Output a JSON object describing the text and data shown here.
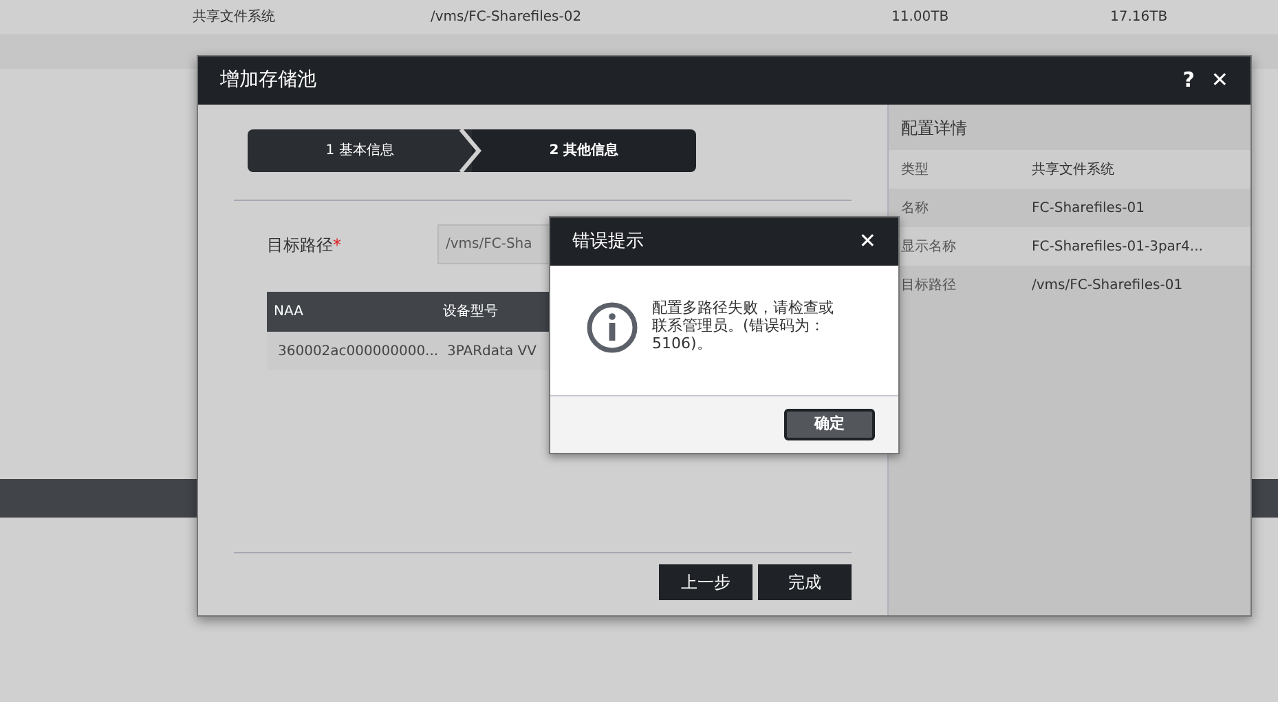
{
  "background_table": {
    "rows": [
      {
        "cells": [
          "共享文件系统",
          "/vms/FC-Sharefiles-02",
          "11.00TB",
          "17.16TB"
        ],
        "selected": false
      }
    ]
  },
  "dialog": {
    "title": "增加存储池",
    "help": "?",
    "close": "✕",
    "steps": [
      {
        "label": "1 基本信息",
        "selected": false
      },
      {
        "label": "2 其他信息",
        "selected": true
      }
    ],
    "target_path": {
      "label": "目标路径",
      "required_mark": "*",
      "value": "/vms/FC-Sha"
    },
    "table": {
      "columns": [
        "NAA",
        "设备型号"
      ],
      "rows": [
        [
          "360002ac000000000...",
          "3PARdata VV"
        ]
      ]
    },
    "buttons": [
      "上一步",
      "完成"
    ],
    "details": {
      "title": "配置详情",
      "rows": [
        {
          "label": "类型",
          "value": "共享文件系统"
        },
        {
          "label": "名称",
          "value": "FC-Sharefiles-01"
        },
        {
          "label": "显示名称",
          "value": "FC-Sharefiles-01-3par4..."
        },
        {
          "label": "目标路径",
          "value": "/vms/FC-Sharefiles-01"
        }
      ]
    }
  },
  "error_dialog": {
    "title": "错误提示",
    "close": "✕",
    "message": "配置多路径失败，请检查或联系管理员。(错误码为：5106)。",
    "button": "确定"
  }
}
